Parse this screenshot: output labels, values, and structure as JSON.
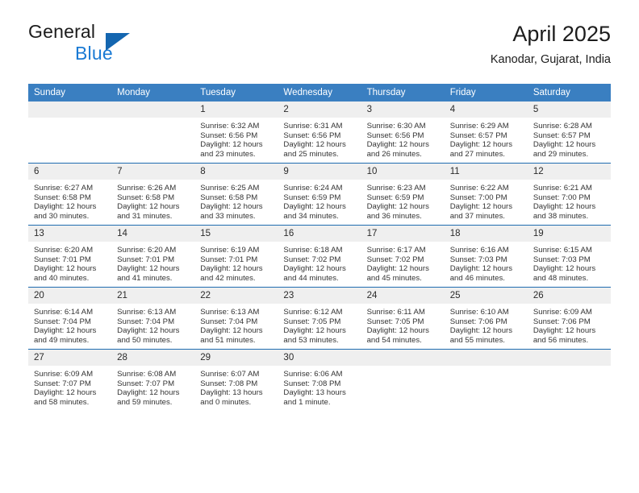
{
  "brand": {
    "name_top": "General",
    "name_bottom": "Blue",
    "accent_color": "#1a7ad4",
    "triangle_color": "#1466b0"
  },
  "header": {
    "title": "April 2025",
    "subtitle": "Kanodar, Gujarat, India"
  },
  "calendar": {
    "header_bg": "#3a7fc1",
    "row_rule_color": "#1f6cb0",
    "daynum_bg": "#efefef",
    "weekdays": [
      "Sunday",
      "Monday",
      "Tuesday",
      "Wednesday",
      "Thursday",
      "Friday",
      "Saturday"
    ],
    "weeks": [
      [
        {
          "day": "",
          "lines": []
        },
        {
          "day": "",
          "lines": []
        },
        {
          "day": "1",
          "lines": [
            "Sunrise: 6:32 AM",
            "Sunset: 6:56 PM",
            "Daylight: 12 hours",
            "and 23 minutes."
          ]
        },
        {
          "day": "2",
          "lines": [
            "Sunrise: 6:31 AM",
            "Sunset: 6:56 PM",
            "Daylight: 12 hours",
            "and 25 minutes."
          ]
        },
        {
          "day": "3",
          "lines": [
            "Sunrise: 6:30 AM",
            "Sunset: 6:56 PM",
            "Daylight: 12 hours",
            "and 26 minutes."
          ]
        },
        {
          "day": "4",
          "lines": [
            "Sunrise: 6:29 AM",
            "Sunset: 6:57 PM",
            "Daylight: 12 hours",
            "and 27 minutes."
          ]
        },
        {
          "day": "5",
          "lines": [
            "Sunrise: 6:28 AM",
            "Sunset: 6:57 PM",
            "Daylight: 12 hours",
            "and 29 minutes."
          ]
        }
      ],
      [
        {
          "day": "6",
          "lines": [
            "Sunrise: 6:27 AM",
            "Sunset: 6:58 PM",
            "Daylight: 12 hours",
            "and 30 minutes."
          ]
        },
        {
          "day": "7",
          "lines": [
            "Sunrise: 6:26 AM",
            "Sunset: 6:58 PM",
            "Daylight: 12 hours",
            "and 31 minutes."
          ]
        },
        {
          "day": "8",
          "lines": [
            "Sunrise: 6:25 AM",
            "Sunset: 6:58 PM",
            "Daylight: 12 hours",
            "and 33 minutes."
          ]
        },
        {
          "day": "9",
          "lines": [
            "Sunrise: 6:24 AM",
            "Sunset: 6:59 PM",
            "Daylight: 12 hours",
            "and 34 minutes."
          ]
        },
        {
          "day": "10",
          "lines": [
            "Sunrise: 6:23 AM",
            "Sunset: 6:59 PM",
            "Daylight: 12 hours",
            "and 36 minutes."
          ]
        },
        {
          "day": "11",
          "lines": [
            "Sunrise: 6:22 AM",
            "Sunset: 7:00 PM",
            "Daylight: 12 hours",
            "and 37 minutes."
          ]
        },
        {
          "day": "12",
          "lines": [
            "Sunrise: 6:21 AM",
            "Sunset: 7:00 PM",
            "Daylight: 12 hours",
            "and 38 minutes."
          ]
        }
      ],
      [
        {
          "day": "13",
          "lines": [
            "Sunrise: 6:20 AM",
            "Sunset: 7:01 PM",
            "Daylight: 12 hours",
            "and 40 minutes."
          ]
        },
        {
          "day": "14",
          "lines": [
            "Sunrise: 6:20 AM",
            "Sunset: 7:01 PM",
            "Daylight: 12 hours",
            "and 41 minutes."
          ]
        },
        {
          "day": "15",
          "lines": [
            "Sunrise: 6:19 AM",
            "Sunset: 7:01 PM",
            "Daylight: 12 hours",
            "and 42 minutes."
          ]
        },
        {
          "day": "16",
          "lines": [
            "Sunrise: 6:18 AM",
            "Sunset: 7:02 PM",
            "Daylight: 12 hours",
            "and 44 minutes."
          ]
        },
        {
          "day": "17",
          "lines": [
            "Sunrise: 6:17 AM",
            "Sunset: 7:02 PM",
            "Daylight: 12 hours",
            "and 45 minutes."
          ]
        },
        {
          "day": "18",
          "lines": [
            "Sunrise: 6:16 AM",
            "Sunset: 7:03 PM",
            "Daylight: 12 hours",
            "and 46 minutes."
          ]
        },
        {
          "day": "19",
          "lines": [
            "Sunrise: 6:15 AM",
            "Sunset: 7:03 PM",
            "Daylight: 12 hours",
            "and 48 minutes."
          ]
        }
      ],
      [
        {
          "day": "20",
          "lines": [
            "Sunrise: 6:14 AM",
            "Sunset: 7:04 PM",
            "Daylight: 12 hours",
            "and 49 minutes."
          ]
        },
        {
          "day": "21",
          "lines": [
            "Sunrise: 6:13 AM",
            "Sunset: 7:04 PM",
            "Daylight: 12 hours",
            "and 50 minutes."
          ]
        },
        {
          "day": "22",
          "lines": [
            "Sunrise: 6:13 AM",
            "Sunset: 7:04 PM",
            "Daylight: 12 hours",
            "and 51 minutes."
          ]
        },
        {
          "day": "23",
          "lines": [
            "Sunrise: 6:12 AM",
            "Sunset: 7:05 PM",
            "Daylight: 12 hours",
            "and 53 minutes."
          ]
        },
        {
          "day": "24",
          "lines": [
            "Sunrise: 6:11 AM",
            "Sunset: 7:05 PM",
            "Daylight: 12 hours",
            "and 54 minutes."
          ]
        },
        {
          "day": "25",
          "lines": [
            "Sunrise: 6:10 AM",
            "Sunset: 7:06 PM",
            "Daylight: 12 hours",
            "and 55 minutes."
          ]
        },
        {
          "day": "26",
          "lines": [
            "Sunrise: 6:09 AM",
            "Sunset: 7:06 PM",
            "Daylight: 12 hours",
            "and 56 minutes."
          ]
        }
      ],
      [
        {
          "day": "27",
          "lines": [
            "Sunrise: 6:09 AM",
            "Sunset: 7:07 PM",
            "Daylight: 12 hours",
            "and 58 minutes."
          ]
        },
        {
          "day": "28",
          "lines": [
            "Sunrise: 6:08 AM",
            "Sunset: 7:07 PM",
            "Daylight: 12 hours",
            "and 59 minutes."
          ]
        },
        {
          "day": "29",
          "lines": [
            "Sunrise: 6:07 AM",
            "Sunset: 7:08 PM",
            "Daylight: 13 hours",
            "and 0 minutes."
          ]
        },
        {
          "day": "30",
          "lines": [
            "Sunrise: 6:06 AM",
            "Sunset: 7:08 PM",
            "Daylight: 13 hours",
            "and 1 minute."
          ]
        },
        {
          "day": "",
          "lines": []
        },
        {
          "day": "",
          "lines": []
        },
        {
          "day": "",
          "lines": []
        }
      ]
    ]
  }
}
